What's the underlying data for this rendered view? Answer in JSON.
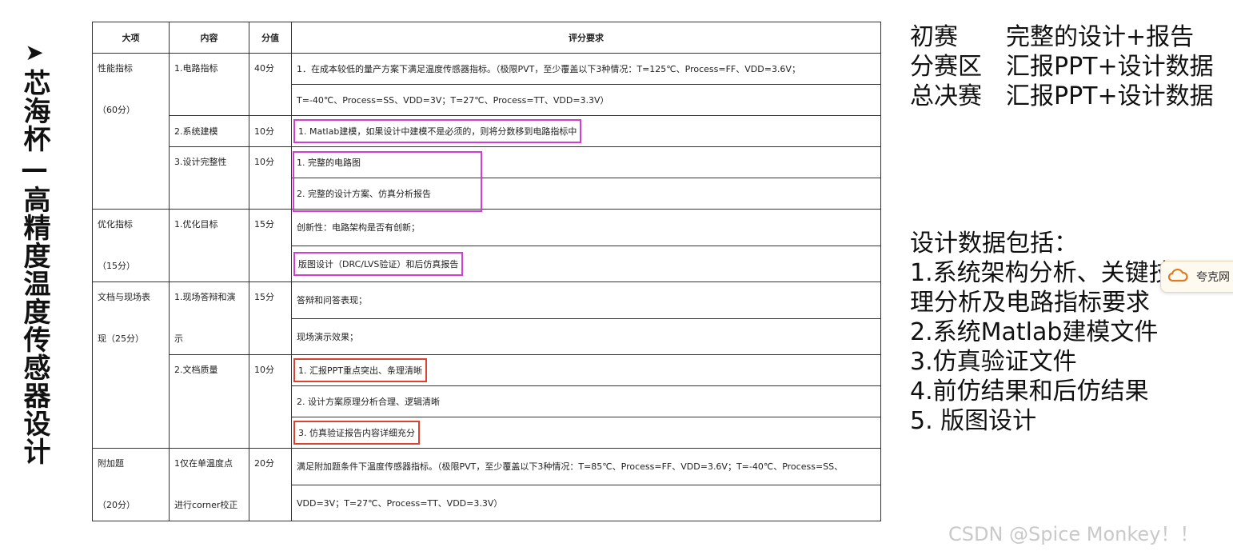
{
  "side_title": {
    "arrow": "➤",
    "text": "芯海杯—高精度温度传感器设计"
  },
  "table": {
    "headers": [
      "大项",
      "内容",
      "分值",
      "评分要求"
    ],
    "perf": {
      "category_line1": "性能指标",
      "category_line2": "（60分）",
      "c1": "1.电路指标",
      "s1": "40分",
      "r1a": "1．在成本较低的量产方案下满足温度传感器指标。（极限PVT，至少覆盖以下3种情况：T=125℃、Process=FF、VDD=3.6V；",
      "r1b": "T=-40℃、Process=SS、VDD=3V；T=27℃、Process=TT、VDD=3.3V）",
      "c2": "2.系统建模",
      "s2": "10分",
      "r2": "1. Matlab建模，如果设计中建模不是必须的，则将分数移到电路指标中",
      "c3": "3.设计完整性",
      "s3": "10分",
      "r3a": "1. 完整的电路图",
      "r3b": "2. 完整的设计方案、仿真分析报告"
    },
    "opt": {
      "category_line1": "优化指标",
      "category_line2": "（15分）",
      "c1": "1.优化目标",
      "s1": "15分",
      "r1": "创新性：电路架构是否有创新；",
      "r2": "版图设计（DRC/LVS验证）和后仿真报告"
    },
    "doc": {
      "category_line1": "文档与现场表",
      "category_line2": "现（25分）",
      "c1_line1": "1.现场答辩和演",
      "c1_line2": "示",
      "s1": "15分",
      "r1": "答辩和问答表现；",
      "r2": "现场演示效果；",
      "c2": "2.文档质量",
      "s2": "10分",
      "r3": "1. 汇报PPT重点突出、条理清晰",
      "r4": "2. 设计方案原理分析合理、逻辑清晰",
      "r5": "3. 仿真验证报告内容详细充分"
    },
    "extra": {
      "category_line1": "附加题",
      "category_line2": "（20分）",
      "c1_line1": "1仅在单温度点",
      "c1_line2": "进行corner校正",
      "s1": "20分",
      "r1a": "满足附加题条件下温度传感器指标。（极限PVT，至少覆盖以下3种情况：T=85℃、Process=FF、VDD=3.6V；T=-40℃、Process=SS、",
      "r1b": "VDD=3V；T=27℃、Process=TT、VDD=3.3V）"
    }
  },
  "stages": [
    {
      "label": "初赛",
      "value": "完整的设计+报告"
    },
    {
      "label": "分赛区",
      "value": "汇报PPT+设计数据"
    },
    {
      "label": "总决赛",
      "value": "汇报PPT+设计数据"
    }
  ],
  "design_data": {
    "heading": "设计数据包括：",
    "items": [
      "1.系统架构分析、关键技",
      "理分析及电路指标要求",
      "2.系统Matlab建模文件",
      "3.仿真验证文件",
      "4.前仿结果和后仿结果",
      "5. 版图设计"
    ]
  },
  "widget": {
    "label": "夸克网",
    "icon": "cloud-icon"
  },
  "watermark": "CSDN @Spice Monkey！！",
  "colors": {
    "magenta_box": "#d23dd6",
    "red_box": "#d9432f"
  }
}
